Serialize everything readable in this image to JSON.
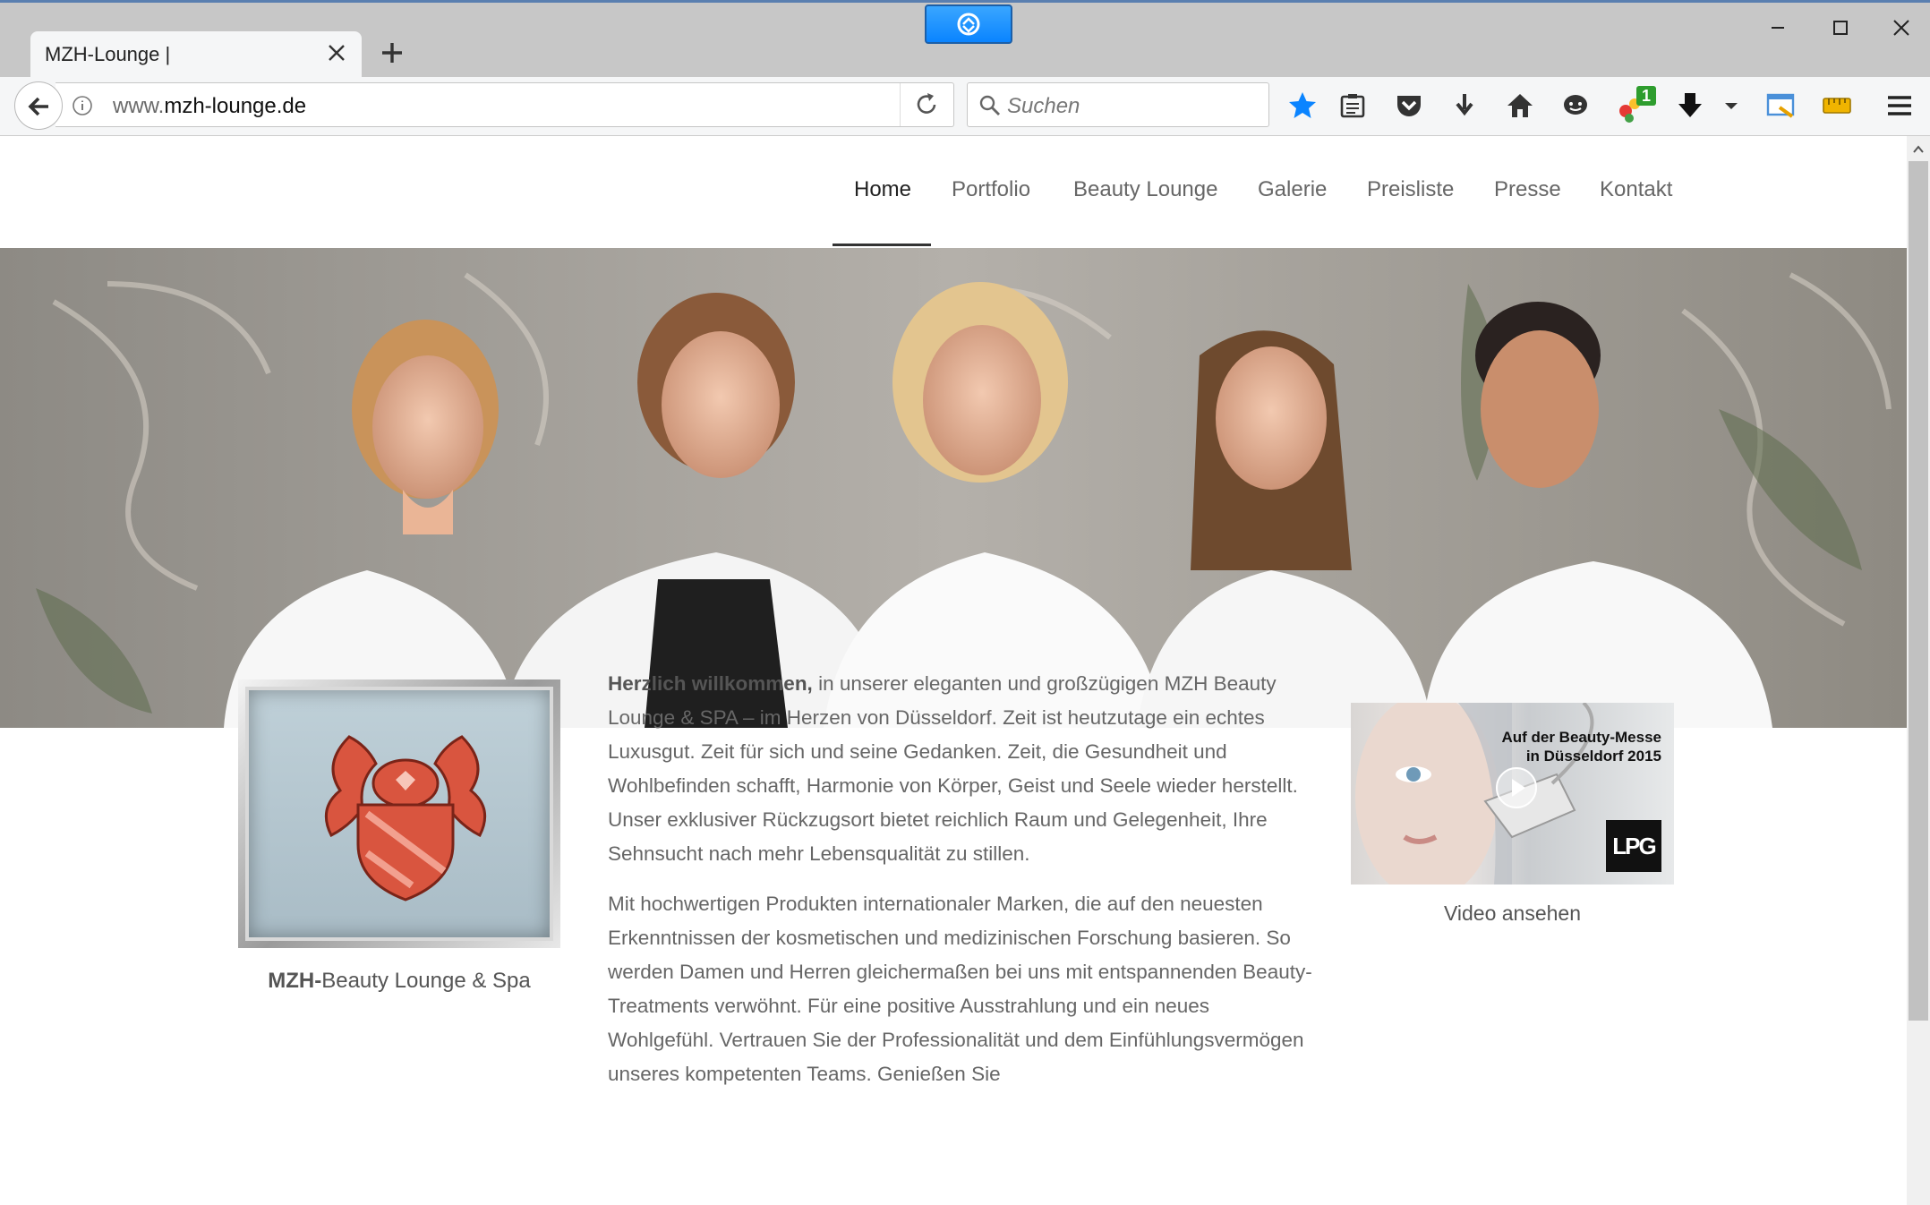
{
  "browser": {
    "tab_title": "MZH-Lounge |",
    "url_prefix": "www.",
    "url_domain": "mzh-lounge.de",
    "search_placeholder": "Suchen",
    "badge_count": "1"
  },
  "nav": {
    "items": [
      "Home",
      "Portfolio",
      "Beauty Lounge",
      "Galerie",
      "Preisliste",
      "Presse",
      "Kontakt"
    ],
    "active": "Home"
  },
  "logo": {
    "caption_bold": "MZH-",
    "caption_rest": "Beauty Lounge & Spa"
  },
  "content": {
    "p1_lead": "Herzlich willkommen,",
    "p1_rest": " in unserer eleganten und großzügigen MZH Beauty Lounge & SPA – im Herzen von Düsseldorf. Zeit ist heutzutage ein echtes Luxusgut. Zeit für sich und seine Gedanken. Zeit, die Gesundheit und Wohlbefinden schafft, Harmonie von Körper, Geist und Seele wieder herstellt. Unser exklusiver Rückzugsort bietet reichlich Raum und Gelegenheit, Ihre Sehnsucht nach mehr Lebensqualität zu stillen.",
    "p2": "Mit hochwertigen Produkten internationaler Marken, die auf den neuesten Erkenntnissen der kosmetischen und medizinischen Forschung basieren. So werden Damen und Herren gleichermaßen bei uns mit entspannenden Beauty-Treatments verwöhnt. Für eine positive Ausstrahlung und ein neues Wohlgefühl. Vertrauen Sie der Professionalität und dem Einfühlungsvermögen unseres kompetenten Teams. Genießen Sie"
  },
  "video": {
    "title_line1": "Auf der Beauty-Messe",
    "title_line2": "in Düsseldorf 2015",
    "brand": "LPG",
    "caption": "Video ansehen"
  },
  "colors": {
    "accent_blue": "#0a84ff",
    "text_gray": "#666666",
    "crest_red": "#d9553f"
  }
}
